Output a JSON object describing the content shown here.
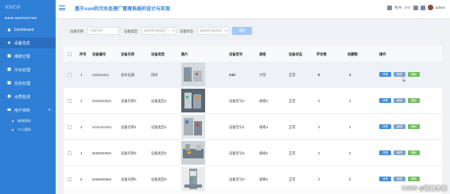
{
  "sidebar": {
    "brand": "vsco",
    "section_title": "MAIN NAVIGATION",
    "items": [
      {
        "label": "Dashboard",
        "icon": "home-icon"
      },
      {
        "label": "设备信息",
        "icon": "device-icon",
        "active": true
      },
      {
        "label": "维修记录",
        "icon": "wrench-icon"
      },
      {
        "label": "污水处理",
        "icon": "water-icon"
      },
      {
        "label": "任务处理",
        "icon": "task-icon"
      },
      {
        "label": "水质检测",
        "icon": "test-icon"
      },
      {
        "label": "用户资料",
        "icon": "user-icon",
        "expandable": true
      }
    ],
    "sub_items": [
      {
        "label": "修改密码"
      },
      {
        "label": "个人资料"
      }
    ]
  },
  "header": {
    "title": "基于ssm的污水处理厂管理系统的设计与实现",
    "weather": "2-6°",
    "city": "杭州",
    "user": "admin"
  },
  "filter": {
    "fields": [
      {
        "label": "设备名称",
        "placeholder": "设备名称"
      },
      {
        "label": "设备类型",
        "placeholder": "请选择设备类型"
      },
      {
        "label": "设备状态",
        "placeholder": "请选择设备状态"
      }
    ],
    "search_label": "搜索"
  },
  "table": {
    "headers": [
      "序号",
      "设备编号",
      "设备名称",
      "设备类型",
      "图片",
      "设备型号",
      "规格",
      "设备状态",
      "评论数",
      "收藏数",
      "操作"
    ],
    "rows": [
      {
        "index": "1",
        "code": "1111111111",
        "name": "滤水设施",
        "type": "排水",
        "model": "A10",
        "spec": "大型",
        "status": "正常",
        "comments": "0",
        "favorites": "1"
      },
      {
        "index": "2",
        "code": "3333333332",
        "name": "设备名称2",
        "type": "设备类型2",
        "model": "设备型号2",
        "spec": "规格2",
        "status": "正常",
        "comments": "0",
        "favorites": "2"
      },
      {
        "index": "3",
        "code": "4444444444",
        "name": "设备名称4",
        "type": "设备类型4",
        "model": "设备型号4",
        "spec": "规格4",
        "status": "正常",
        "comments": "0",
        "favorites": "4"
      },
      {
        "index": "4",
        "code": "5555555555",
        "name": "设备名称5",
        "type": "设备类型5",
        "model": "设备型号5",
        "spec": "规格5",
        "status": "正常",
        "comments": "0",
        "favorites": "5"
      },
      {
        "index": "5",
        "code": "6666666666",
        "name": "设备名称6",
        "type": "设备类型6",
        "model": "设备型号6",
        "spec": "规格6",
        "status": "正常",
        "comments": "0",
        "favorites": "6"
      }
    ],
    "actions": {
      "detail": "详情",
      "edit": "修改",
      "delete": "删除"
    }
  },
  "watermark": "CSDN @弥路学姐",
  "colors": {
    "sidebar": "#2f7fd6",
    "accent": "#2f7fd6",
    "detail": "#3e8fe0",
    "edit": "#7ea4c6",
    "delete": "#6fbf5a"
  }
}
